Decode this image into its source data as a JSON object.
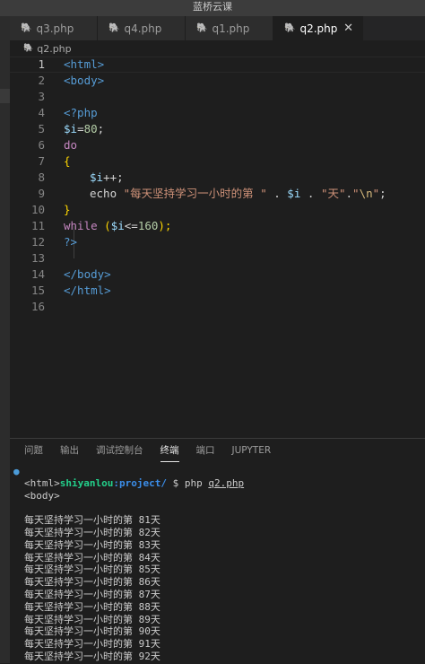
{
  "window": {
    "title": "蓝桥云课"
  },
  "tabs": [
    {
      "label": "q3.php",
      "active": false
    },
    {
      "label": "q4.php",
      "active": false
    },
    {
      "label": "q1.php",
      "active": false
    },
    {
      "label": "q2.php",
      "active": true,
      "close": "✕"
    }
  ],
  "breadcrumb": {
    "file": "q2.php"
  },
  "editor": {
    "current_line": 1,
    "lines": [
      {
        "n": "1"
      },
      {
        "n": "2"
      },
      {
        "n": "3"
      },
      {
        "n": "4"
      },
      {
        "n": "5"
      },
      {
        "n": "6"
      },
      {
        "n": "7"
      },
      {
        "n": "8"
      },
      {
        "n": "9"
      },
      {
        "n": "10"
      },
      {
        "n": "11"
      },
      {
        "n": "12"
      },
      {
        "n": "13"
      },
      {
        "n": "14"
      },
      {
        "n": "15"
      },
      {
        "n": "16"
      }
    ],
    "code": {
      "l1": "<html>",
      "l2": "<body>",
      "l4": "<?php",
      "l5_var": "$i",
      "l5_op": "=",
      "l5_num": "80",
      "l5_end": ";",
      "l6": "do",
      "l7": "{",
      "l8_var": "$i",
      "l8_op": "++;",
      "l9_kw": "echo",
      "l9_str": "\"每天坚持学习一小时的第 \"",
      "l9_dot1": " . ",
      "l9_var": "$i",
      "l9_dot2": " . ",
      "l9_str2": "\"天\"",
      "l9_dot3": ".",
      "l9_q1": "\"",
      "l9_esc": "\\n",
      "l9_q2": "\"",
      "l9_end": ";",
      "l10": "}",
      "l11_kw": "while",
      "l11_p1": " (",
      "l11_var": "$i",
      "l11_op": "<=",
      "l11_num": "160",
      "l11_p2": ");",
      "l12": "?>",
      "l14": "</body>",
      "l15": "</html>"
    }
  },
  "panel": {
    "tabs": [
      {
        "label": "问题",
        "active": false
      },
      {
        "label": "输出",
        "active": false
      },
      {
        "label": "调试控制台",
        "active": false
      },
      {
        "label": "终端",
        "active": true
      },
      {
        "label": "端口",
        "active": false
      },
      {
        "label": "JUPYTER",
        "active": false
      }
    ],
    "terminal": {
      "user": "shiyanlou",
      "path": ":project/",
      "prompt_symbol": " $ ",
      "command": "php ",
      "command_file": "q2.php",
      "output": [
        "<html>",
        "<body>",
        "",
        "每天坚持学习一小时的第 81天",
        "每天坚持学习一小时的第 82天",
        "每天坚持学习一小时的第 83天",
        "每天坚持学习一小时的第 84天",
        "每天坚持学习一小时的第 85天",
        "每天坚持学习一小时的第 86天",
        "每天坚持学习一小时的第 87天",
        "每天坚持学习一小时的第 88天",
        "每天坚持学习一小时的第 89天",
        "每天坚持学习一小时的第 90天",
        "每天坚持学习一小时的第 91天",
        "每天坚持学习一小时的第 92天"
      ]
    }
  }
}
